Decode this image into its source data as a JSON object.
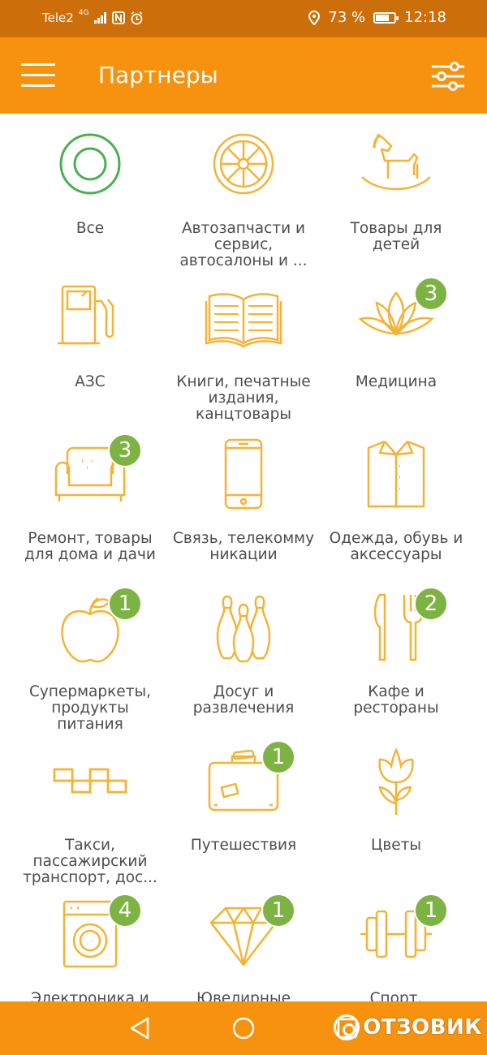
{
  "status_bar": {
    "carrier": "Tele2",
    "network": "4G",
    "battery_percent": "73 %",
    "battery_level": 0.73,
    "time": "12:18"
  },
  "header": {
    "title": "Партнеры"
  },
  "categories": [
    {
      "label": "Все",
      "icon": "all-circle-icon",
      "badge": null
    },
    {
      "label": "Автозапчасти и сервис, автосалоны и ...",
      "icon": "car-wheel-icon",
      "badge": null
    },
    {
      "label": "Товары для детей",
      "icon": "rocking-horse-icon",
      "badge": null
    },
    {
      "label": "АЗС",
      "icon": "fuel-pump-icon",
      "badge": null
    },
    {
      "label": "Книги, печатные издания, канцтовары",
      "icon": "book-icon",
      "badge": null
    },
    {
      "label": "Медицина",
      "icon": "lotus-icon",
      "badge": "3"
    },
    {
      "label": "Ремонт, товары для дома и дачи",
      "icon": "armchair-icon",
      "badge": "3"
    },
    {
      "label": "Связь, телекомму никации",
      "icon": "smartphone-icon",
      "badge": null
    },
    {
      "label": "Одежда, обувь и аксессуары",
      "icon": "shirt-icon",
      "badge": null
    },
    {
      "label": "Супермаркеты, продукты питания",
      "icon": "apple-icon",
      "badge": "1"
    },
    {
      "label": "Досуг и развлечения",
      "icon": "bowling-pins-icon",
      "badge": null
    },
    {
      "label": "Кафе и рестораны",
      "icon": "knife-fork-icon",
      "badge": "2"
    },
    {
      "label": "Такси, пассажирский транспорт, дос...",
      "icon": "taxi-checker-icon",
      "badge": null
    },
    {
      "label": "Путешествия",
      "icon": "suitcase-icon",
      "badge": "1"
    },
    {
      "label": "Цветы",
      "icon": "tulip-icon",
      "badge": null
    },
    {
      "label": "Электроника и",
      "icon": "washing-machine-icon",
      "badge": "4"
    },
    {
      "label": "Ювелирные",
      "icon": "diamond-icon",
      "badge": "1"
    },
    {
      "label": "Спорт,",
      "icon": "dumbbell-icon",
      "badge": "1"
    }
  ],
  "watermark": "ОТЗОВИК",
  "colors": {
    "accent": "#f7920f",
    "status_bar": "#cc6e0a",
    "icon_stroke": "#f5b335",
    "icon_all": "#4caf50",
    "badge": "#7cb342",
    "label": "#4d4d4d"
  }
}
